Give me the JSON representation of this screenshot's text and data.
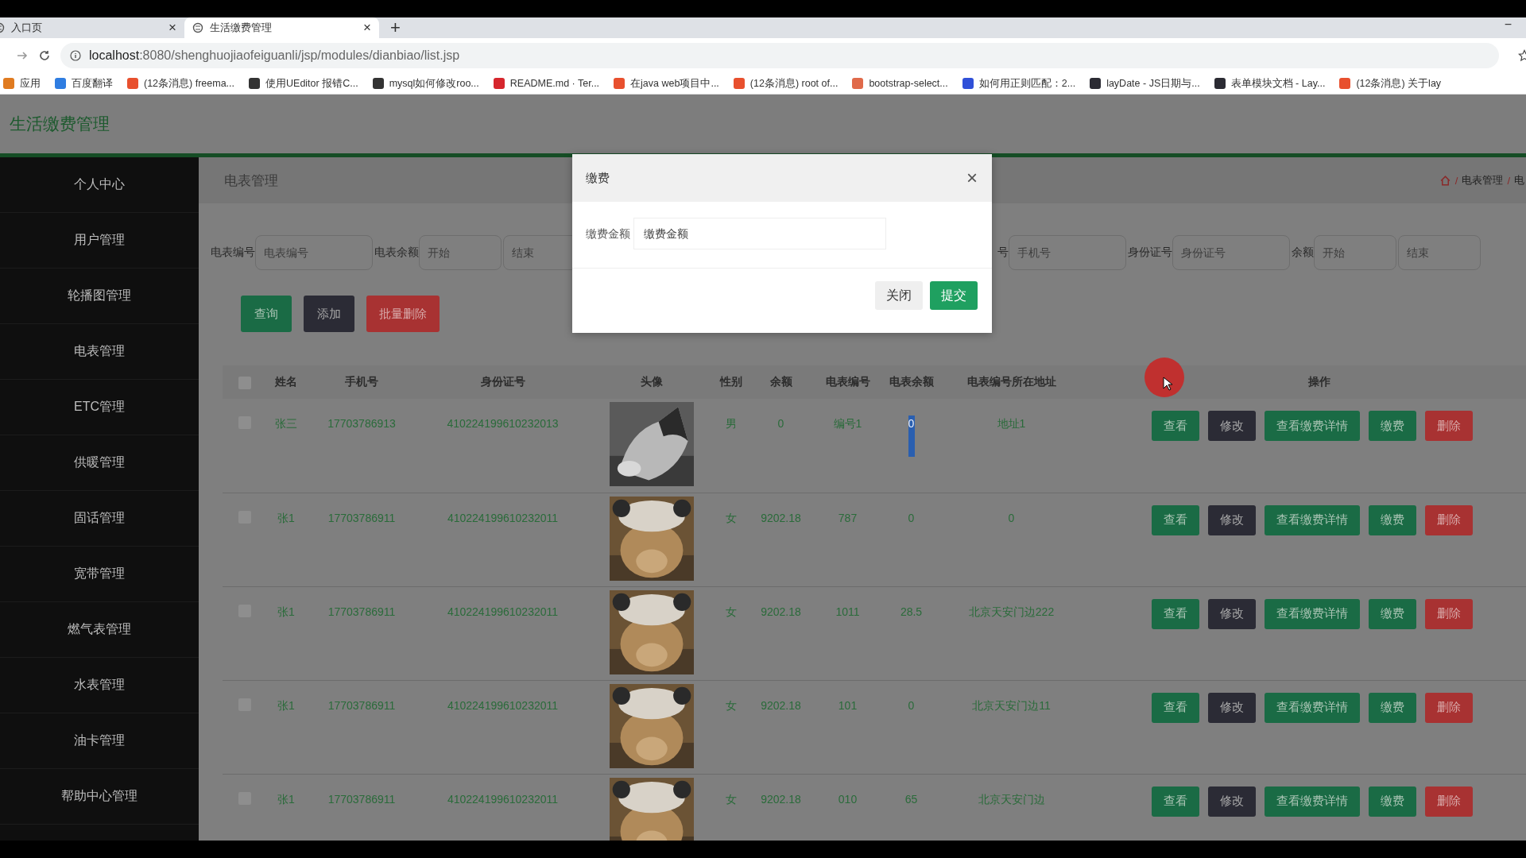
{
  "browser": {
    "tabs": [
      {
        "title": "入口页",
        "selected": false,
        "close": "×"
      },
      {
        "title": "生活缴费管理",
        "selected": true,
        "close": "×"
      }
    ],
    "new_tab": "+",
    "minimize": "−",
    "address": {
      "host": "localhost",
      "path": ":8080/shenghuojiaofeiguanli/jsp/modules/dianbiao/list.jsp"
    },
    "bookmarks": [
      {
        "label": "应用",
        "color": "#e07b20"
      },
      {
        "label": "百度翻译",
        "color": "#2f7de1"
      },
      {
        "label": "(12条消息) freema...",
        "color": "#e8502e"
      },
      {
        "label": "使用UEditor 报错C...",
        "color": "#333333"
      },
      {
        "label": "mysql如何修改roo...",
        "color": "#333333"
      },
      {
        "label": "README.md · Ter...",
        "color": "#d6262d"
      },
      {
        "label": "在java web项目中...",
        "color": "#e8502e"
      },
      {
        "label": "(12条消息) root of...",
        "color": "#e8502e"
      },
      {
        "label": "bootstrap-select...",
        "color": "#e06a4a"
      },
      {
        "label": "如何用正则匹配：2...",
        "color": "#3050d8"
      },
      {
        "label": "layDate - JS日期与...",
        "color": "#2b2b33"
      },
      {
        "label": "表单模块文档 - Lay...",
        "color": "#2b2b33"
      },
      {
        "label": "(12条消息) 关于lay",
        "color": "#e8502e"
      }
    ]
  },
  "app": {
    "title": "生活缴费管理"
  },
  "sidebar": {
    "items": [
      {
        "label": "个人中心"
      },
      {
        "label": "用户管理"
      },
      {
        "label": "轮播图管理"
      },
      {
        "label": "电表管理"
      },
      {
        "label": "ETC管理"
      },
      {
        "label": "供暖管理"
      },
      {
        "label": "固话管理"
      },
      {
        "label": "宽带管理"
      },
      {
        "label": "燃气表管理"
      },
      {
        "label": "水表管理"
      },
      {
        "label": "油卡管理"
      },
      {
        "label": "帮助中心管理"
      }
    ]
  },
  "page_title": "电表管理",
  "breadcrumb": [
    {
      "kind": "sep",
      "text": "/"
    },
    {
      "kind": "link",
      "text": "电表管理"
    },
    {
      "kind": "sep",
      "text": "/"
    },
    {
      "kind": "link",
      "text": "电"
    }
  ],
  "search_left": [
    {
      "label": "电表编号",
      "fields": [
        {
          "placeholder": "电表编号"
        }
      ]
    },
    {
      "label": "电表余额",
      "fields": [
        {
          "placeholder": "开始"
        },
        {
          "placeholder": "结束"
        }
      ]
    }
  ],
  "search_right": [
    {
      "label": "号",
      "fields": [
        {
          "placeholder": "手机号"
        }
      ]
    },
    {
      "label": "身份证号",
      "fields": [
        {
          "placeholder": "身份证号"
        }
      ]
    },
    {
      "label": "余额",
      "fields": [
        {
          "placeholder": "开始"
        },
        {
          "placeholder": "结束"
        }
      ]
    }
  ],
  "toolbar": [
    {
      "label": "查询",
      "kind": "green"
    },
    {
      "label": "添加",
      "kind": "dark"
    },
    {
      "label": "批量删除",
      "kind": "red"
    }
  ],
  "table": {
    "select_all_checked": false,
    "columns": [
      "姓名",
      "手机号",
      "身份证号",
      "头像",
      "性别",
      "余额",
      "电表编号",
      "电表余额",
      "电表编号所在地址",
      "操作"
    ],
    "rows": [
      {
        "checked": false,
        "name": "张三",
        "phone": "17703786913",
        "id_number": "410224199610232013",
        "gender": "男",
        "balance": "0",
        "meter_no": "编号1",
        "meter_balance": "0",
        "meter_balance_selected": true,
        "address": "地址1",
        "actions": [
          {
            "label": "查看",
            "kind": "green"
          },
          {
            "label": "修改",
            "kind": "dark"
          },
          {
            "label": "查看缴费详情",
            "kind": "green"
          },
          {
            "label": "缴费",
            "kind": "green"
          },
          {
            "label": "删除",
            "kind": "red"
          }
        ]
      },
      {
        "checked": false,
        "name": "张1",
        "phone": "17703786911",
        "id_number": "410224199610232011",
        "gender": "女",
        "balance": "9202.18",
        "meter_no": "787",
        "meter_balance": "0",
        "meter_balance_selected": false,
        "address": "0",
        "actions": [
          {
            "label": "查看",
            "kind": "green"
          },
          {
            "label": "修改",
            "kind": "dark"
          },
          {
            "label": "查看缴费详情",
            "kind": "green"
          },
          {
            "label": "缴费",
            "kind": "green"
          },
          {
            "label": "删除",
            "kind": "red"
          }
        ]
      },
      {
        "checked": false,
        "name": "张1",
        "phone": "17703786911",
        "id_number": "410224199610232011",
        "gender": "女",
        "balance": "9202.18",
        "meter_no": "1011",
        "meter_balance": "28.5",
        "meter_balance_selected": false,
        "address": "北京天安门边222",
        "actions": [
          {
            "label": "查看",
            "kind": "green"
          },
          {
            "label": "修改",
            "kind": "dark"
          },
          {
            "label": "查看缴费详情",
            "kind": "green"
          },
          {
            "label": "缴费",
            "kind": "green"
          },
          {
            "label": "删除",
            "kind": "red"
          }
        ]
      },
      {
        "checked": false,
        "name": "张1",
        "phone": "17703786911",
        "id_number": "410224199610232011",
        "gender": "女",
        "balance": "9202.18",
        "meter_no": "101",
        "meter_balance": "0",
        "meter_balance_selected": false,
        "address": "北京天安门边11",
        "actions": [
          {
            "label": "查看",
            "kind": "green"
          },
          {
            "label": "修改",
            "kind": "dark"
          },
          {
            "label": "查看缴费详情",
            "kind": "green"
          },
          {
            "label": "缴费",
            "kind": "green"
          },
          {
            "label": "删除",
            "kind": "red"
          }
        ]
      },
      {
        "checked": false,
        "name": "张1",
        "phone": "17703786911",
        "id_number": "410224199610232011",
        "gender": "女",
        "balance": "9202.18",
        "meter_no": "010",
        "meter_balance": "65",
        "meter_balance_selected": false,
        "address": "北京天安门边",
        "actions": [
          {
            "label": "查看",
            "kind": "green"
          },
          {
            "label": "修改",
            "kind": "dark"
          },
          {
            "label": "查看缴费详情",
            "kind": "green"
          },
          {
            "label": "缴费",
            "kind": "green"
          },
          {
            "label": "删除",
            "kind": "red"
          }
        ]
      }
    ]
  },
  "modal": {
    "title": "缴费",
    "close": "×",
    "label": "缴费金额",
    "placeholder": "缴费金额",
    "buttons": [
      {
        "label": "关闭",
        "kind": "plain"
      },
      {
        "label": "提交",
        "kind": "primary"
      }
    ]
  }
}
